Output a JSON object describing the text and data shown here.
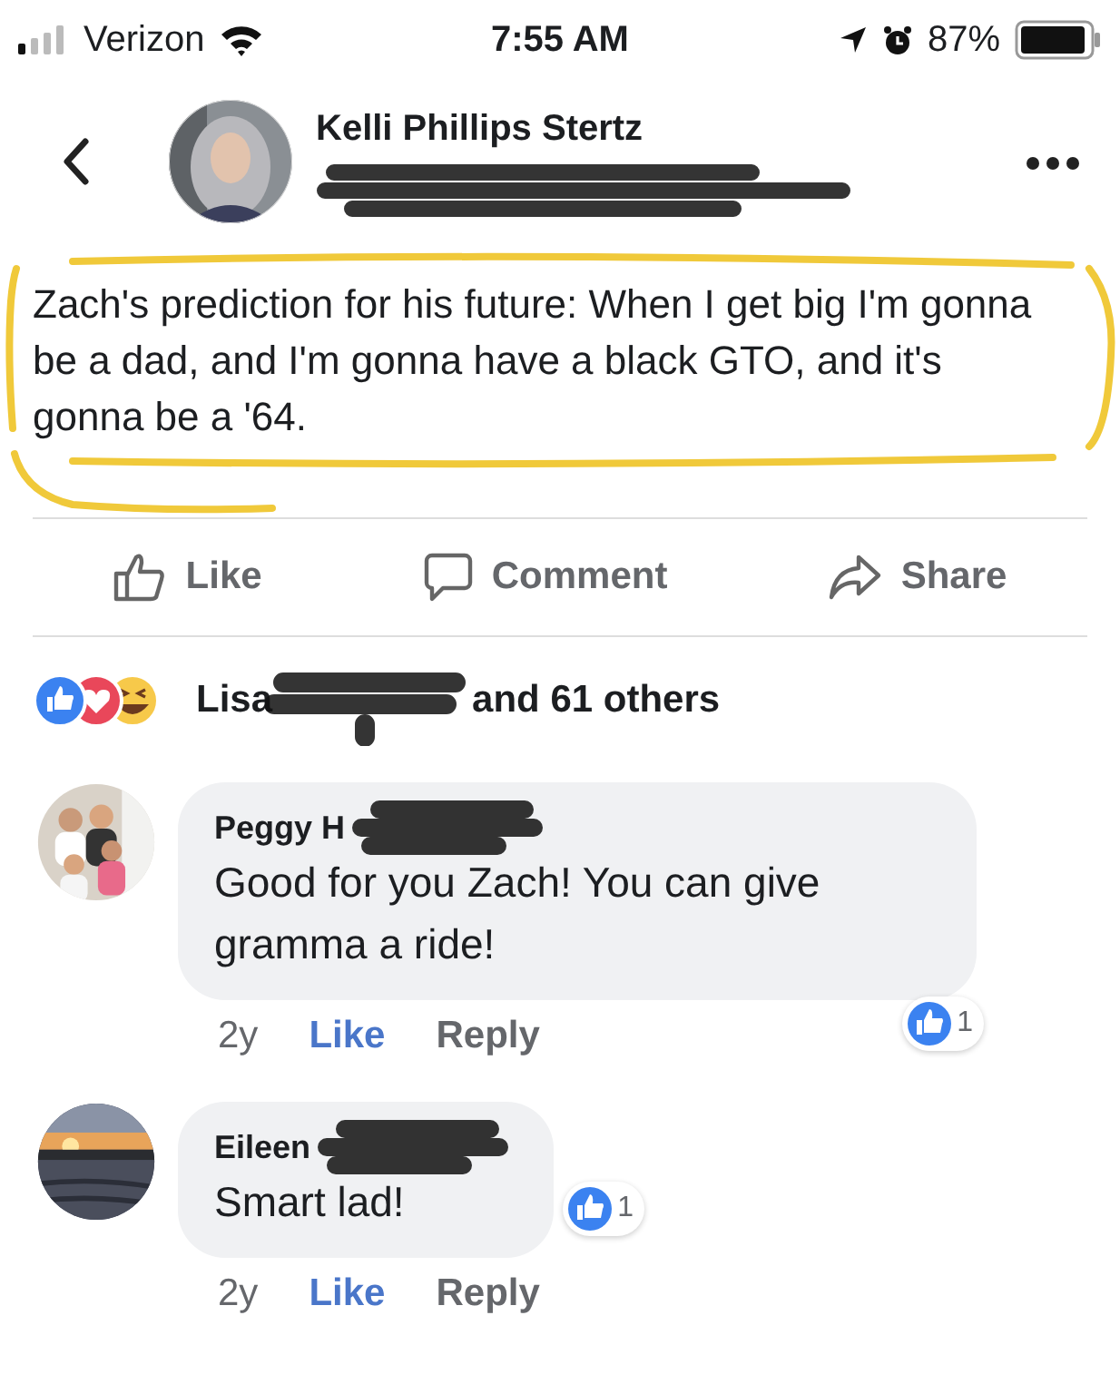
{
  "status_bar": {
    "carrier": "Verizon",
    "time": "7:55 AM",
    "battery": "87%"
  },
  "post": {
    "author": "Kelli Phillips Stertz",
    "text": "Zach's prediction for his future: When I get big I'm gonna be a dad, and I'm gonna have a black GTO, and it's gonna be a '64."
  },
  "actions": [
    {
      "kind": "like",
      "label": "Like"
    },
    {
      "kind": "comment",
      "label": "Comment"
    },
    {
      "kind": "share",
      "label": "Share"
    }
  ],
  "reactions": {
    "name": "Lisa",
    "others": "and 61 others"
  },
  "comments": [
    {
      "name": "Peggy H",
      "text": "Good for you Zach!  You can give gramma a ride!",
      "likes": "1",
      "time": "2y",
      "like": "Like",
      "reply": "Reply"
    },
    {
      "name": "Eileen",
      "text": "Smart lad!",
      "likes": "1",
      "time": "2y",
      "like": "Like",
      "reply": "Reply"
    }
  ]
}
